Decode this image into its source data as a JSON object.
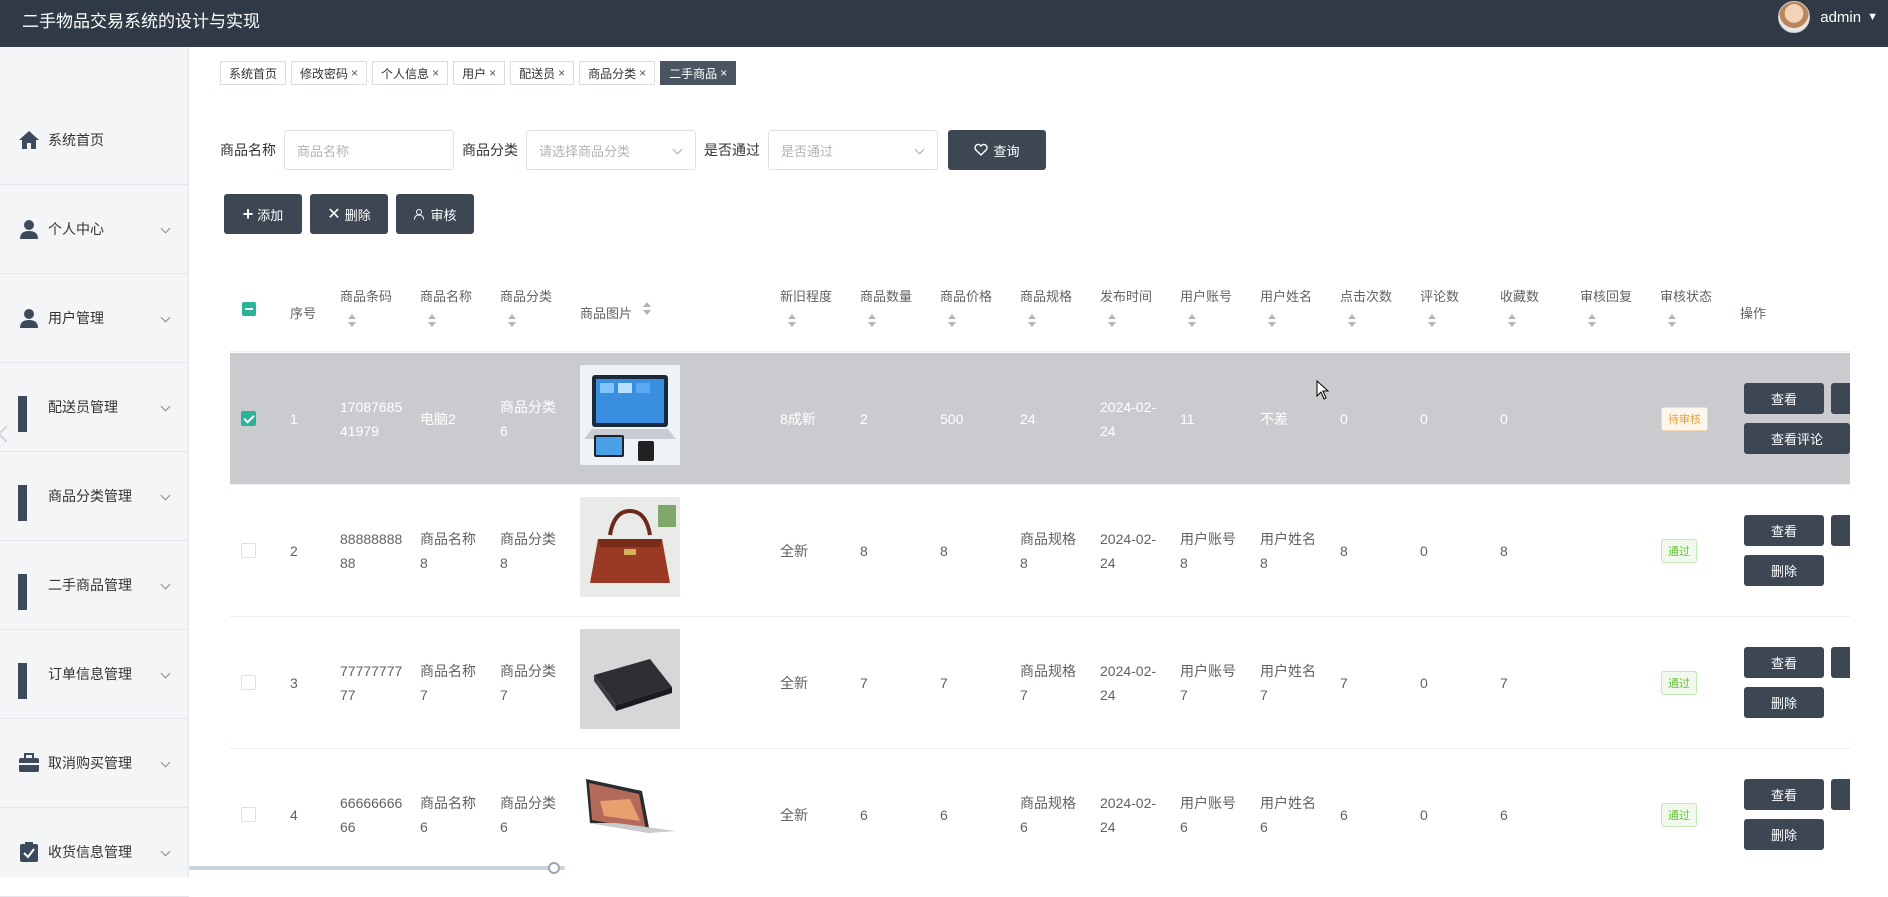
{
  "app": {
    "title": "二手物品交易系统的设计与实现",
    "user": "admin"
  },
  "sidebar": {
    "items": [
      {
        "label": "系统首页",
        "icon": "home-icon"
      },
      {
        "label": "个人中心",
        "icon": "person-icon"
      },
      {
        "label": "用户管理",
        "icon": "person-icon"
      },
      {
        "label": "配送员管理",
        "icon": "grid-icon"
      },
      {
        "label": "商品分类管理",
        "icon": "grid-icon"
      },
      {
        "label": "二手商品管理",
        "icon": "grid-icon"
      },
      {
        "label": "订单信息管理",
        "icon": "grid-icon"
      },
      {
        "label": "取消购买管理",
        "icon": "briefcase-icon"
      },
      {
        "label": "收货信息管理",
        "icon": "clipboard-icon"
      }
    ]
  },
  "tabs": [
    {
      "label": "系统首页"
    },
    {
      "label": "修改密码"
    },
    {
      "label": "个人信息"
    },
    {
      "label": "用户"
    },
    {
      "label": "配送员"
    },
    {
      "label": "商品分类"
    },
    {
      "label": "二手商品"
    }
  ],
  "search": {
    "name_label": "商品名称",
    "name_placeholder": "商品名称",
    "category_label": "商品分类",
    "category_placeholder": "请选择商品分类",
    "approved_label": "是否通过",
    "approved_placeholder": "是否通过",
    "query_label": "查询"
  },
  "actions": {
    "add": "添加",
    "delete": "删除",
    "audit": "审核"
  },
  "table": {
    "columns": [
      "序号",
      "商品条码",
      "商品名称",
      "商品分类",
      "商品图片",
      "新旧程度",
      "商品数量",
      "商品价格",
      "商品规格",
      "发布时间",
      "用户账号",
      "用户姓名",
      "点击次数",
      "评论数",
      "收藏数",
      "审核回复",
      "审核状态",
      "操作"
    ],
    "rows": [
      {
        "idx": "1",
        "code": "1708768541979",
        "name": "电脑2",
        "category": "商品分类6",
        "condition": "8成新",
        "qty": "2",
        "price": "500",
        "spec": "24",
        "time": "2024-02-24",
        "account": "11",
        "username": "不差",
        "clicks": "0",
        "comments": "0",
        "favorites": "0",
        "status": "待审核",
        "btn1": "查看",
        "btn2": "查看评论"
      },
      {
        "idx": "2",
        "code": "8888888888",
        "name": "商品名称8",
        "category": "商品分类8",
        "condition": "全新",
        "qty": "8",
        "price": "8",
        "spec": "商品规格8",
        "time": "2024-02-24",
        "account": "用户账号8",
        "username": "用户姓名8",
        "clicks": "8",
        "comments": "0",
        "favorites": "8",
        "status": "通过",
        "btn1": "查看",
        "btn2": "删除"
      },
      {
        "idx": "3",
        "code": "7777777777",
        "name": "商品名称7",
        "category": "商品分类7",
        "condition": "全新",
        "qty": "7",
        "price": "7",
        "spec": "商品规格7",
        "time": "2024-02-24",
        "account": "用户账号7",
        "username": "用户姓名7",
        "clicks": "7",
        "comments": "0",
        "favorites": "7",
        "status": "通过",
        "btn1": "查看",
        "btn2": "删除"
      },
      {
        "idx": "4",
        "code": "6666666666",
        "name": "商品名称6",
        "category": "商品分类6",
        "condition": "全新",
        "qty": "6",
        "price": "6",
        "spec": "商品规格6",
        "time": "2024-02-24",
        "account": "用户账号6",
        "username": "用户姓名6",
        "clicks": "6",
        "comments": "0",
        "favorites": "6",
        "status": "通过",
        "btn1": "查看",
        "btn2": "删除"
      }
    ]
  }
}
